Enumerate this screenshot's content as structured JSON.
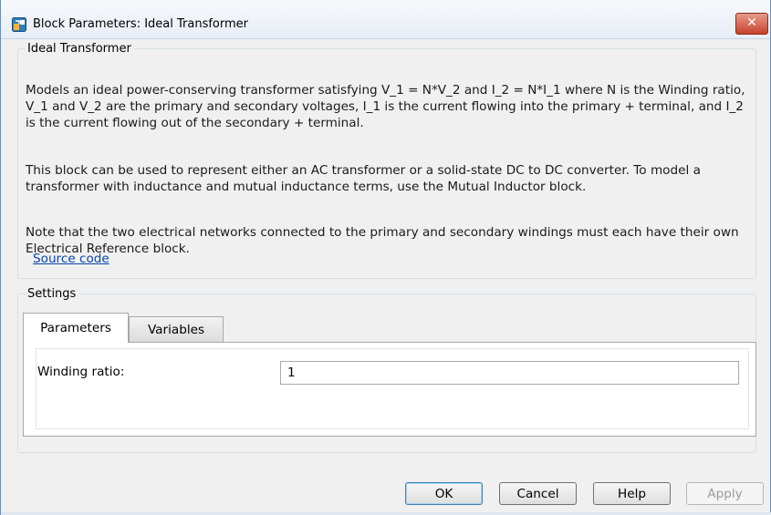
{
  "window": {
    "title": "Block Parameters: Ideal Transformer",
    "close_symbol": "✕",
    "icon": "simulink-block-icon"
  },
  "block_group": {
    "legend": "Ideal Transformer",
    "description": [
      "Models an ideal power-conserving transformer satisfying V_1 = N*V_2 and I_2 = N*I_1 where N is the Winding ratio, V_1 and V_2 are the primary and secondary voltages, I_1 is the current flowing into the primary + terminal, and I_2 is the current flowing out of the secondary + terminal.",
      "This block can be used to represent either an AC transformer or a solid-state DC to DC converter. To model a transformer with inductance and mutual inductance terms, use the Mutual Inductor block.",
      "Note that the two electrical networks connected to the primary and secondary windings must each have their own Electrical Reference block."
    ],
    "source_link": "Source code"
  },
  "settings": {
    "legend": "Settings",
    "tabs": [
      {
        "label": "Parameters",
        "active": true
      },
      {
        "label": "Variables",
        "active": false
      }
    ],
    "parameters": {
      "winding_ratio_label": "Winding ratio:",
      "winding_ratio_value": "1"
    }
  },
  "buttons": {
    "ok": "OK",
    "cancel": "Cancel",
    "help": "Help",
    "apply": "Apply"
  },
  "colors": {
    "link": "#0645ad",
    "close_button": "#c8412c",
    "ok_focus": "#3c7fb1"
  }
}
